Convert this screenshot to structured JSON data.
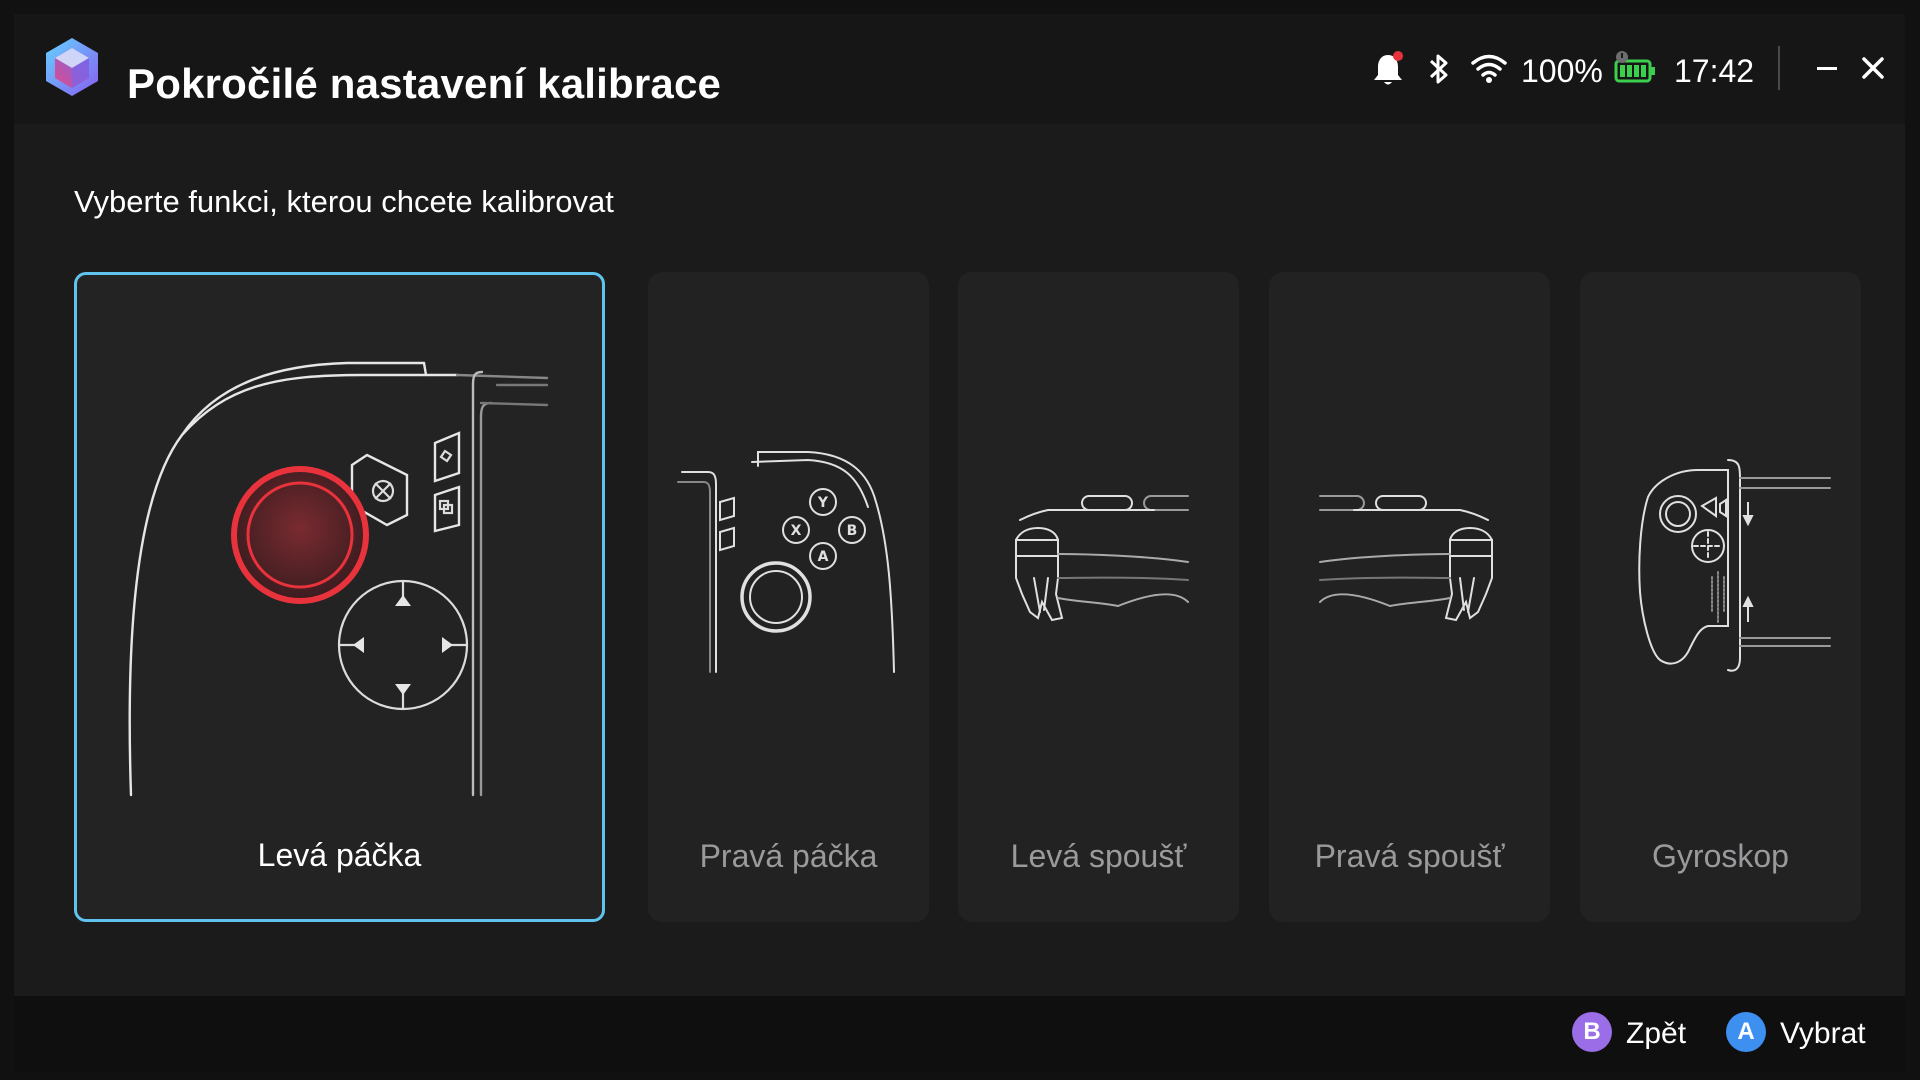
{
  "header": {
    "title": "Pokročilé nastavení kalibrace",
    "logo_icon": "app-logo-icon",
    "status": {
      "battery_percent": "100%",
      "time": "17:42",
      "icons": [
        "bell-icon",
        "bluetooth-icon",
        "wifi-icon",
        "battery-icon"
      ]
    },
    "window_controls": [
      "minimize-icon",
      "close-icon"
    ]
  },
  "main": {
    "subtitle": "Vyberte funkci, kterou chcete kalibrovat",
    "cards": [
      {
        "label": "Levá páčka",
        "selected": true,
        "icon": "left-stick-controller-icon"
      },
      {
        "label": "Pravá páčka",
        "selected": false,
        "icon": "right-stick-controller-icon"
      },
      {
        "label": "Levá spoušť",
        "selected": false,
        "icon": "left-trigger-icon"
      },
      {
        "label": "Pravá spoušť",
        "selected": false,
        "icon": "right-trigger-icon"
      },
      {
        "label": "Gyroskop",
        "selected": false,
        "icon": "gyroscope-icon"
      }
    ]
  },
  "footer": {
    "hints": [
      {
        "key": "B",
        "label": "Zpět"
      },
      {
        "key": "A",
        "label": "Vybrat"
      }
    ]
  },
  "colors": {
    "accent_selected_border": "#5fc3ee",
    "stick_highlight": "#e8323c",
    "battery_green": "#3ccf4e",
    "notification_dot": "#e8323c",
    "b_button": "#9b6ee8",
    "a_button": "#3d8ff0"
  }
}
